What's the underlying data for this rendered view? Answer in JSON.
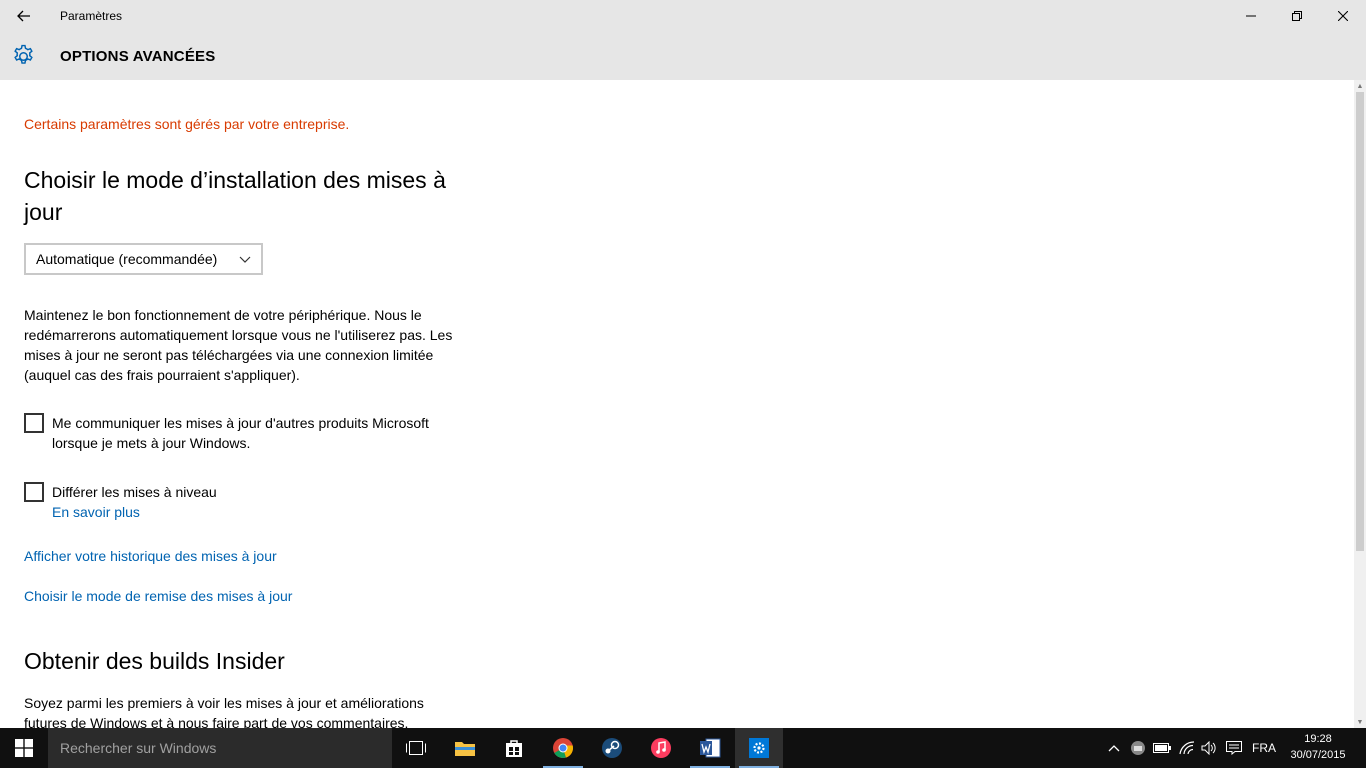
{
  "window": {
    "title": "Paramètres",
    "page_title": "OPTIONS AVANCÉES"
  },
  "content": {
    "managed_notice": "Certains paramètres sont gérés par votre entreprise.",
    "install_heading": "Choisir le mode d’installation des mises à jour",
    "install_mode_selected": "Automatique (recommandée)",
    "install_description": "Maintenez le bon fonctionnement de votre périphérique. Nous le redémarrerons automatiquement lorsque vous ne l'utiliserez pas. Les mises à jour ne seront pas téléchargées via une connexion limitée (auquel cas des frais pourraient s'appliquer).",
    "checkbox_other_products": {
      "label": "Me communiquer les mises à jour d'autres produits Microsoft lorsque je mets à jour Windows.",
      "checked": false
    },
    "checkbox_defer_upgrades": {
      "label": "Différer les mises à niveau",
      "checked": false
    },
    "learn_more": "En savoir plus",
    "link_history": "Afficher votre historique des mises à jour",
    "link_delivery": "Choisir le mode de remise des mises à jour",
    "insider_heading": "Obtenir des builds Insider",
    "insider_description": "Soyez parmi les premiers à voir les mises à jour et améliorations futures de Windows et à nous faire part de vos commentaires."
  },
  "taskbar": {
    "search_placeholder": "Rechercher sur Windows",
    "pinned_apps": [
      "task-view",
      "file-explorer",
      "store",
      "chrome",
      "steam",
      "itunes",
      "word",
      "settings"
    ],
    "active_app": "settings",
    "language": "FRA",
    "time": "19:28",
    "date": "30/07/2015"
  },
  "colors": {
    "accent": "#0063b1",
    "warning": "#d83b01",
    "header_bg": "#e6e6e6",
    "taskbar_bg": "#101010"
  }
}
